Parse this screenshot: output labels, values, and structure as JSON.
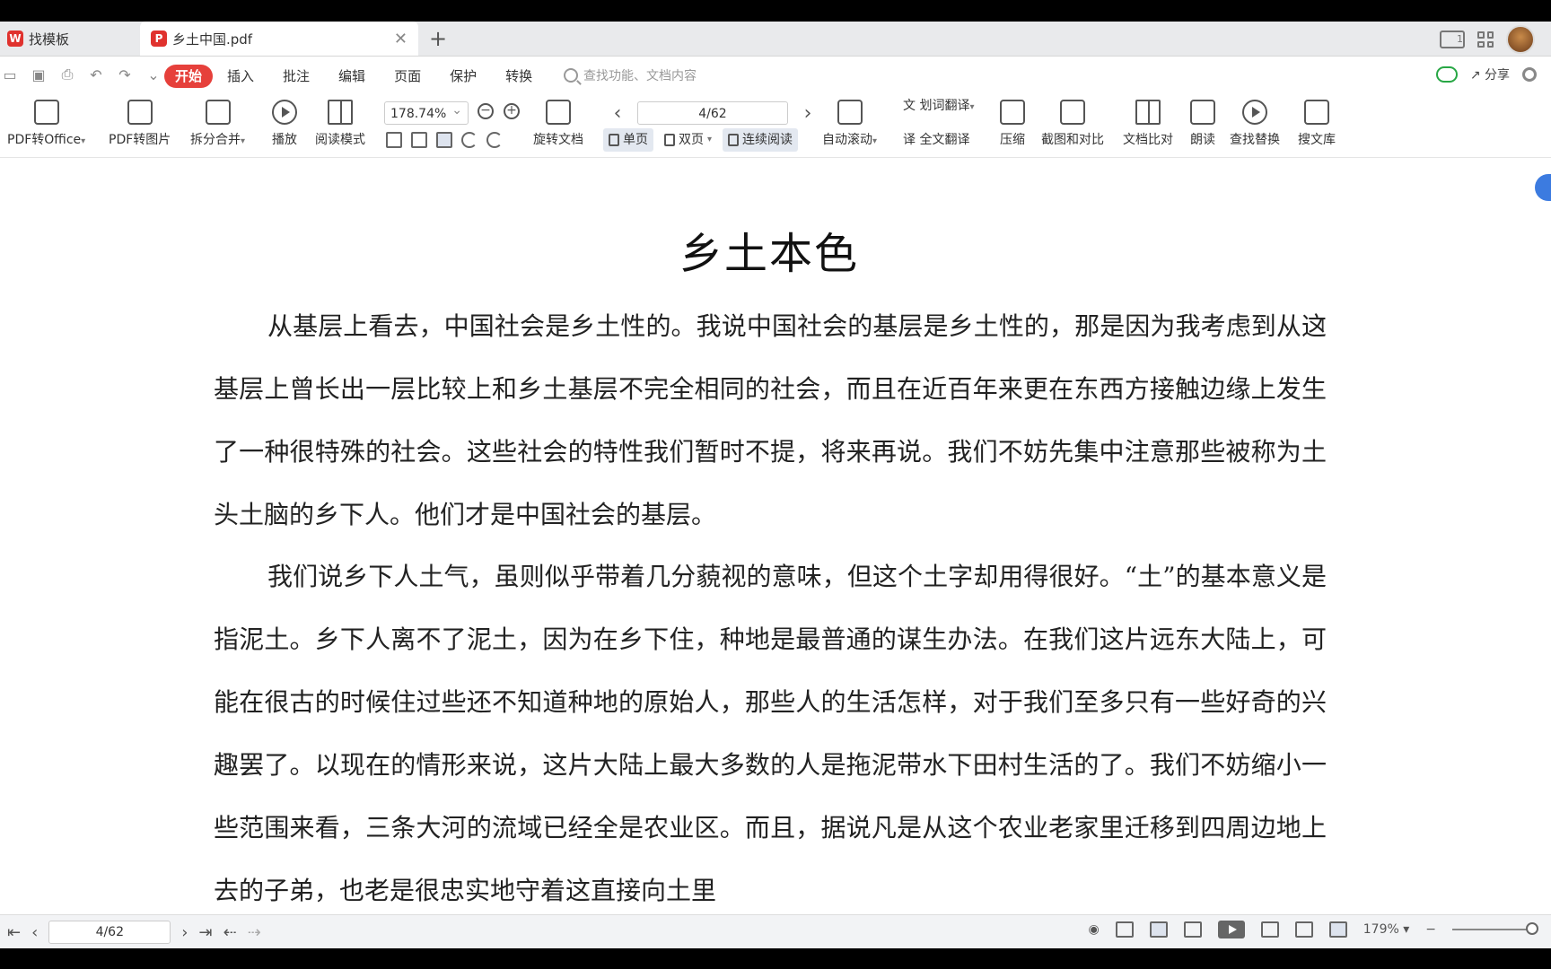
{
  "tabs": [
    {
      "label": "找模板",
      "active": false
    },
    {
      "label": "乡土中国.pdf",
      "active": true
    }
  ],
  "menu": {
    "items": [
      "开始",
      "插入",
      "批注",
      "编辑",
      "页面",
      "保护",
      "转换"
    ],
    "active": "开始",
    "search_placeholder": "查找功能、文档内容",
    "share_label": "分享"
  },
  "toolbar": {
    "pdf_to_office": "PDF转Office",
    "pdf_to_image": "PDF转图片",
    "split_merge": "拆分合并",
    "play": "播放",
    "read_mode": "阅读模式",
    "zoom_value": "178.74%",
    "rotate_doc": "旋转文档",
    "page_value": "4/62",
    "single_page": "单页",
    "double_page": "双页",
    "continuous": "连续阅读",
    "auto_scroll": "自动滚动",
    "word_translate": "划词翻译",
    "full_translate": "全文翻译",
    "compress": "压缩",
    "screenshot_compare": "截图和对比",
    "doc_compare": "文档比对",
    "read_aloud": "朗读",
    "find_replace": "查找替换",
    "search_library": "搜文库"
  },
  "document": {
    "title": "乡土本色",
    "paragraphs": [
      "从基层上看去，中国社会是乡土性的。我说中国社会的基层是乡土性的，那是因为我考虑到从这基层上曾长出一层比较上和乡土基层不完全相同的社会，而且在近百年来更在东西方接触边缘上发生了一种很特殊的社会。这些社会的特性我们暂时不提，将来再说。我们不妨先集中注意那些被称为土头土脑的乡下人。他们才是中国社会的基层。",
      "我们说乡下人土气，虽则似乎带着几分藐视的意味，但这个土字却用得很好。“土”的基本意义是指泥土。乡下人离不了泥土，因为在乡下住，种地是最普通的谋生办法。在我们这片远东大陆上，可能在很古的时候住过些还不知道种地的原始人，那些人的生活怎样，对于我们至多只有一些好奇的兴趣罢了。以现在的情形来说，这片大陆上最大多数的人是拖泥带水下田村生活的了。我们不妨缩小一些范围来看，三条大河的流域已经全是农业区。而且，据说凡是从这个农业老家里迁移到四周边地上去的子弟，也老是很忠实地守着这直接向土里"
    ]
  },
  "statusbar": {
    "page_value": "4/62",
    "zoom_value": "179%"
  }
}
